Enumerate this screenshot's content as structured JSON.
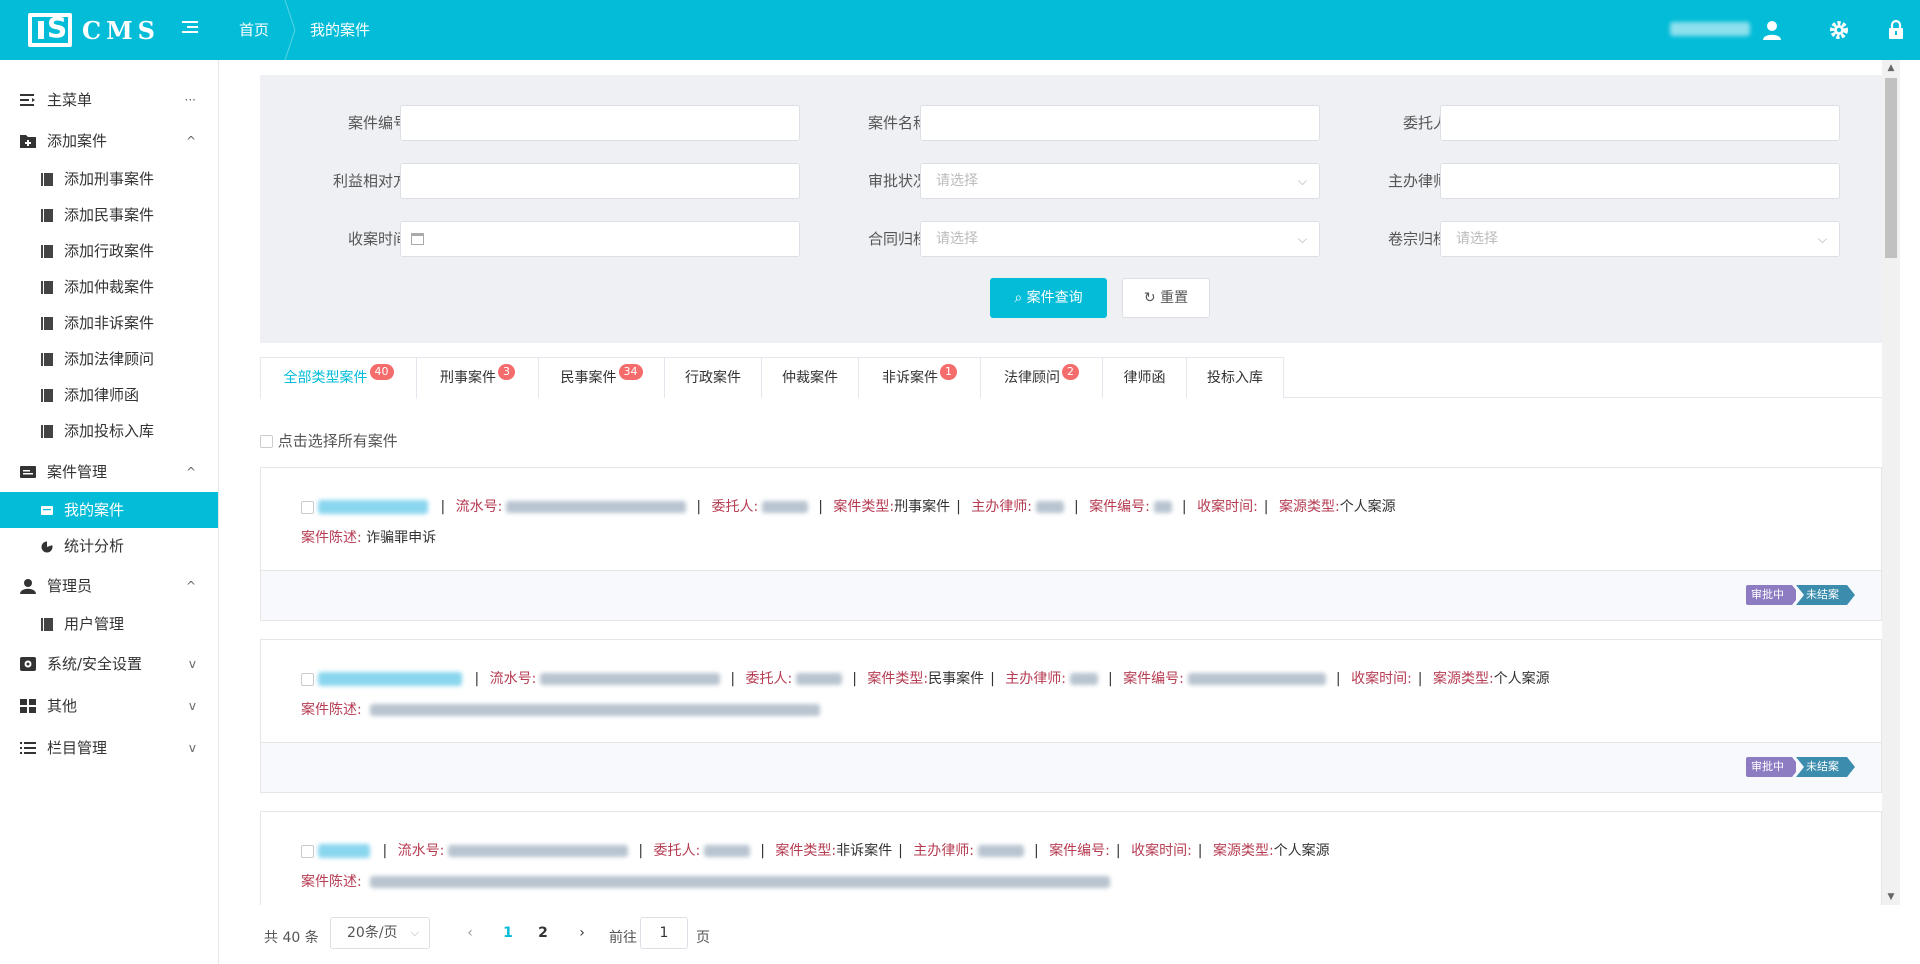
{
  "header": {
    "logo_text": "CMS",
    "breadcrumb": [
      "首页",
      "我的案件"
    ],
    "colors": {
      "primary": "#03bcd8",
      "red_label": "#b63c52",
      "badge": "#f56c6c"
    }
  },
  "sidebar": {
    "groups": [
      {
        "label": "主菜单",
        "icon": "main-menu-icon",
        "indicator": "···"
      },
      {
        "label": "添加案件",
        "icon": "folder-add-icon",
        "indicator": "^",
        "items": [
          "添加刑事案件",
          "添加民事案件",
          "添加行政案件",
          "添加仲裁案件",
          "添加非诉案件",
          "添加法律顾问",
          "添加律师函",
          "添加投标入库"
        ]
      },
      {
        "label": "案件管理",
        "icon": "case-management-icon",
        "indicator": "^",
        "items": [
          "我的案件",
          "统计分析"
        ]
      },
      {
        "label": "管理员",
        "icon": "user-icon",
        "indicator": "^",
        "items": [
          "用户管理"
        ]
      },
      {
        "label": "系统/安全设置",
        "icon": "system-settings-icon",
        "indicator": "v"
      },
      {
        "label": "其他",
        "icon": "grid-icon",
        "indicator": "v"
      },
      {
        "label": "栏目管理",
        "icon": "list-icon",
        "indicator": "v"
      }
    ],
    "active_item": "我的案件"
  },
  "filters": {
    "fields": [
      {
        "label": "案件编号",
        "value": "",
        "placeholder": ""
      },
      {
        "label": "案件名称",
        "value": "",
        "placeholder": ""
      },
      {
        "label": "委托人",
        "value": "",
        "placeholder": ""
      },
      {
        "label": "利益相对方",
        "value": "",
        "placeholder": ""
      },
      {
        "label": "审批状况",
        "value": "",
        "placeholder": "请选择"
      },
      {
        "label": "主办律师",
        "value": "",
        "placeholder": ""
      },
      {
        "label": "收案时间",
        "value": "",
        "placeholder": ""
      },
      {
        "label": "合同归档",
        "value": "",
        "placeholder": "请选择"
      },
      {
        "label": "卷宗归档",
        "value": "",
        "placeholder": "请选择"
      }
    ],
    "search_button": "案件查询",
    "reset_button": "重置"
  },
  "tabs": [
    {
      "label": "全部类型案件",
      "badge": "40"
    },
    {
      "label": "刑事案件",
      "badge": "3"
    },
    {
      "label": "民事案件",
      "badge": "34"
    },
    {
      "label": "行政案件",
      "badge": ""
    },
    {
      "label": "仲裁案件",
      "badge": ""
    },
    {
      "label": "非诉案件",
      "badge": "1"
    },
    {
      "label": "法律顾问",
      "badge": "2"
    },
    {
      "label": "律师函",
      "badge": ""
    },
    {
      "label": "投标入库",
      "badge": ""
    }
  ],
  "select_all_label": "点击选择所有案件",
  "case_labels": {
    "serial": "流水号:",
    "client": "委托人:",
    "case_type": "案件类型:",
    "lawyer": "主办律师:",
    "case_no": "案件编号:",
    "receive_time": "收案时间:",
    "source_type": "案源类型:",
    "description": "案件陈述:"
  },
  "cases": [
    {
      "case_type": "刑事案件",
      "source_type": "个人案源",
      "description": "诈骗罪申诉",
      "status": [
        "审批中",
        "未结案"
      ]
    },
    {
      "case_type": "民事案件",
      "source_type": "个人案源",
      "description": "",
      "status": [
        "审批中",
        "未结案"
      ]
    },
    {
      "case_type": "非诉案件",
      "source_type": "个人案源",
      "description": "",
      "status": []
    }
  ],
  "pagination": {
    "total": "共 40 条",
    "page_size": "20条/页",
    "pages": [
      "1",
      "2"
    ],
    "current_page": "1",
    "goto_label": "前往",
    "goto_value": "1",
    "page_suffix": "页"
  }
}
